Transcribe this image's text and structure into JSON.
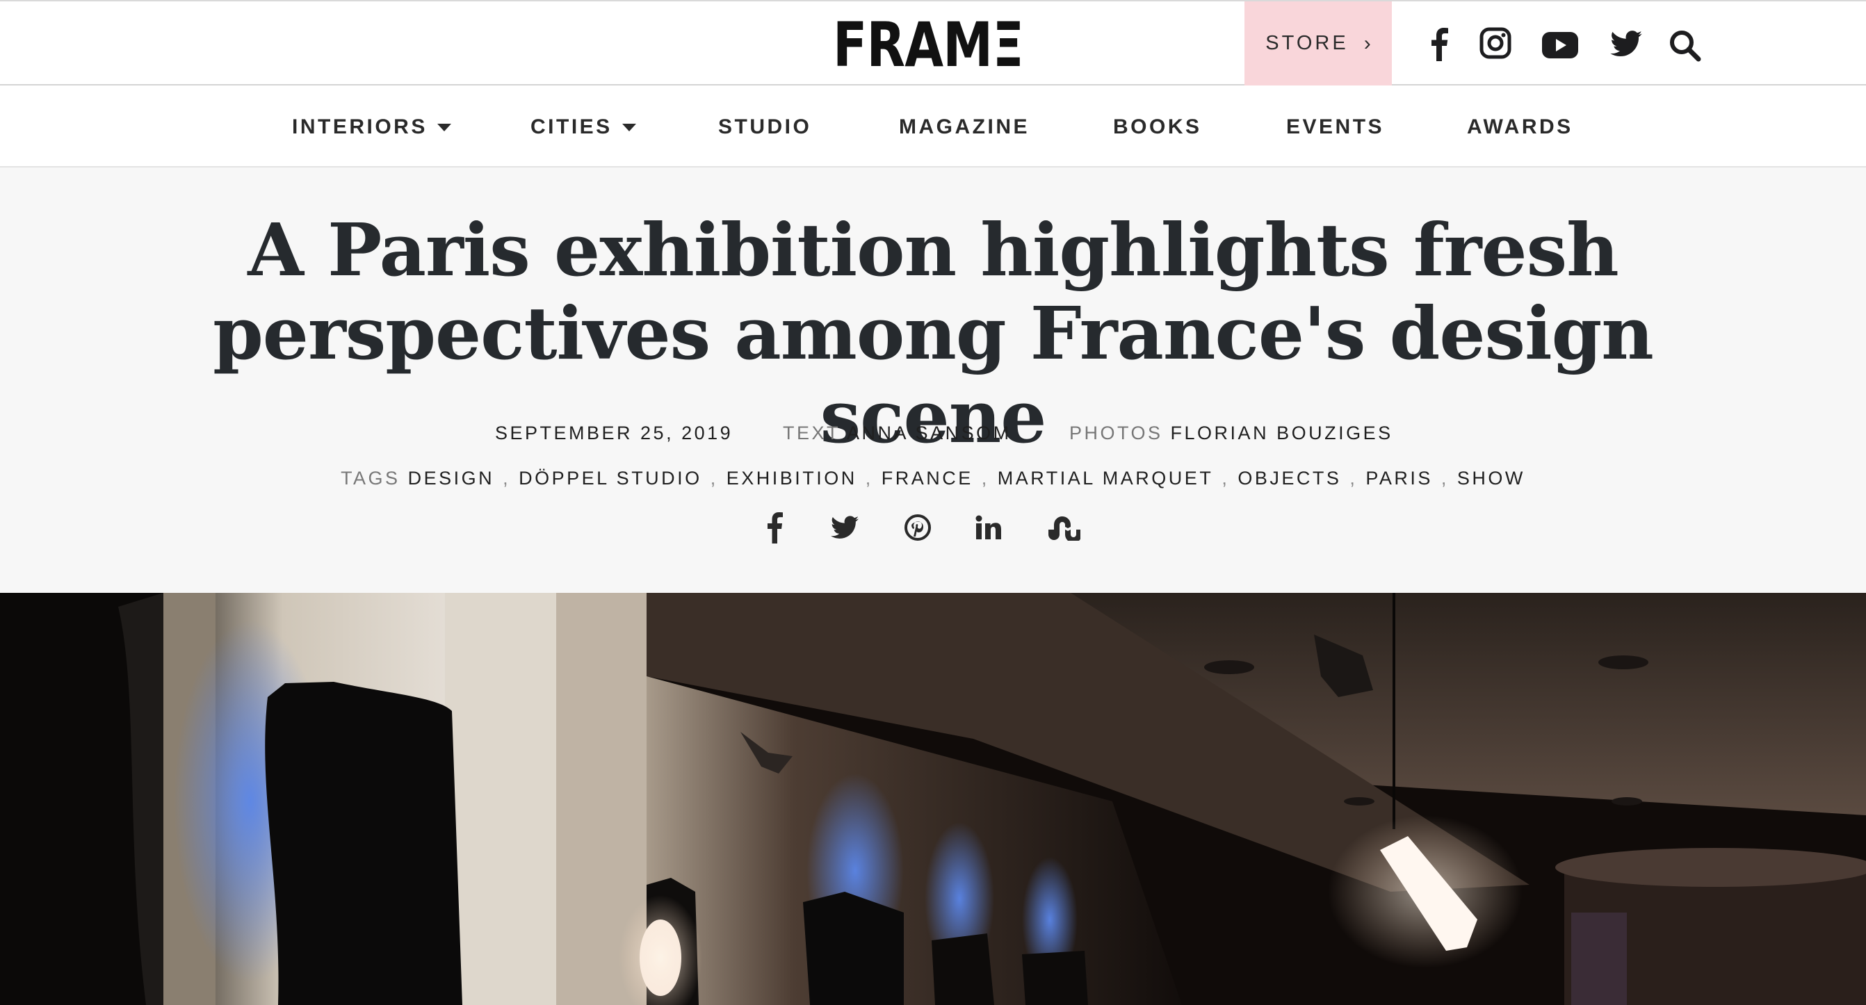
{
  "header": {
    "logo_text": "FRAMΞ",
    "store_label": "STORE",
    "store_chevron": "›",
    "social_icons": [
      "facebook-icon",
      "instagram-icon",
      "youtube-icon",
      "twitter-icon",
      "search-icon"
    ],
    "store_bg_color": "#f9d6da"
  },
  "nav": {
    "items": [
      {
        "label": "INTERIORS",
        "dropdown": true
      },
      {
        "label": "CITIES",
        "dropdown": true
      },
      {
        "label": "STUDIO",
        "dropdown": false
      },
      {
        "label": "MAGAZINE",
        "dropdown": false
      },
      {
        "label": "BOOKS",
        "dropdown": false
      },
      {
        "label": "EVENTS",
        "dropdown": false
      },
      {
        "label": "AWARDS",
        "dropdown": false
      }
    ]
  },
  "article": {
    "headline_line1": "A Paris exhibition highlights fresh",
    "headline_line2": "perspectives among France's design scene",
    "date": "SEPTEMBER 25, 2019",
    "text_label": "TEXT",
    "author": "ANNA SANSOM",
    "photos_label": "PHOTOS",
    "photographer": "FLORIAN BOUZIGES",
    "tags_label": "TAGS",
    "tags": [
      "DESIGN",
      "DÖPPEL STUDIO",
      "EXHIBITION",
      "FRANCE",
      "MARTIAL MARQUET",
      "OBJECTS",
      "PARIS",
      "SHOW"
    ],
    "tag_separator": ",",
    "share_icons": [
      "facebook-icon",
      "twitter-icon",
      "pinterest-icon",
      "linkedin-icon",
      "stumbleupon-icon"
    ]
  }
}
